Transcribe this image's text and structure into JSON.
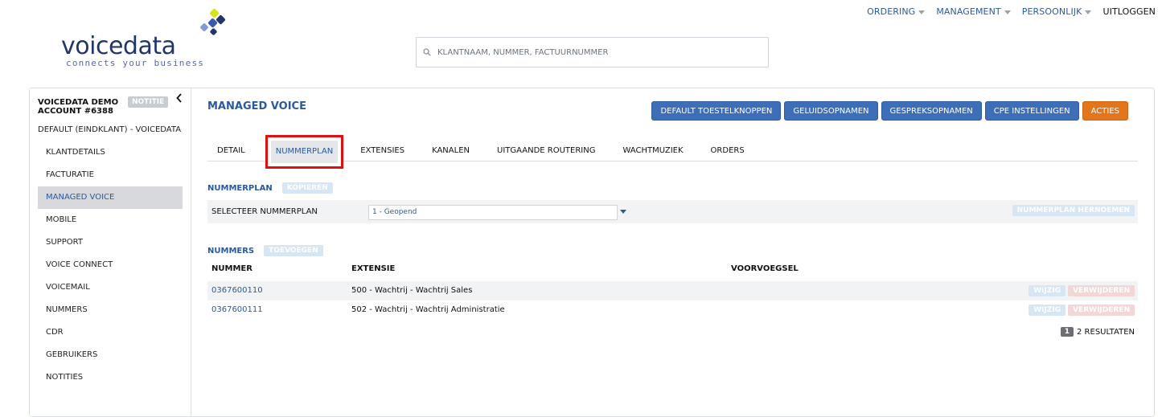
{
  "topnav": {
    "items": [
      {
        "label": "ORDERING",
        "dropdown": true
      },
      {
        "label": "MANAGEMENT",
        "dropdown": true
      },
      {
        "label": "PERSOONLIJK",
        "dropdown": true
      },
      {
        "label": "UITLOGGEN",
        "dropdown": false
      }
    ]
  },
  "logo": {
    "word": "voicedata",
    "tagline": "connects your business"
  },
  "search": {
    "placeholder": "KLANTNAAM, NUMMER, FACTUURNUMMER",
    "value": "",
    "icon": "search-icon"
  },
  "sidebar": {
    "account": "VOICEDATA DEMO ACCOUNT #6388",
    "notitie_label": "NOTITIE",
    "collapse_icon": "chevron-left-icon",
    "default_label": "DEFAULT (EINDKLANT) - VOICEDATA",
    "items": [
      {
        "label": "KLANTDETAILS",
        "active": false
      },
      {
        "label": "FACTURATIE",
        "active": false
      },
      {
        "label": "MANAGED VOICE",
        "active": true
      },
      {
        "label": "MOBILE",
        "active": false
      },
      {
        "label": "SUPPORT",
        "active": false
      },
      {
        "label": "VOICE CONNECT",
        "active": false
      },
      {
        "label": "VOICEMAIL",
        "active": false
      },
      {
        "label": "NUMMERS",
        "active": false
      },
      {
        "label": "CDR",
        "active": false
      },
      {
        "label": "GEBRUIKERS",
        "active": false
      },
      {
        "label": "NOTITIES",
        "active": false
      }
    ]
  },
  "main": {
    "title": "MANAGED VOICE",
    "actions": [
      {
        "label": "DEFAULT TOESTELKNOPPEN",
        "variant": "blue"
      },
      {
        "label": "GELUIDSOPNAMEN",
        "variant": "blue"
      },
      {
        "label": "GESPREKSOPNAMEN",
        "variant": "blue"
      },
      {
        "label": "CPE INSTELLINGEN",
        "variant": "blue"
      },
      {
        "label": "ACTIES",
        "variant": "orange"
      }
    ],
    "tabs": [
      {
        "label": "DETAIL",
        "active": false
      },
      {
        "label": "NUMMERPLAN",
        "active": true
      },
      {
        "label": "EXTENSIES",
        "active": false
      },
      {
        "label": "KANALEN",
        "active": false
      },
      {
        "label": "UITGAANDE ROUTERING",
        "active": false
      },
      {
        "label": "WACHTMUZIEK",
        "active": false
      },
      {
        "label": "ORDERS",
        "active": false
      }
    ],
    "nummerplan": {
      "heading": "NUMMERPLAN",
      "copy_label": "KOPIEREN",
      "select_label": "SELECTEER NUMMERPLAN",
      "select_value": "1 - Geopend",
      "rename_label": "NUMMERPLAN HERNOEMEN"
    },
    "nummers": {
      "heading": "NUMMERS",
      "add_label": "TOEVOEGEN",
      "columns": [
        "NUMMER",
        "EXTENSIE",
        "VOORVOEGSEL"
      ],
      "rows": [
        {
          "nummer": "0367600110",
          "extensie": "500 - Wachtrij - Wachtrij Sales",
          "voorvoegsel": ""
        },
        {
          "nummer": "0367600111",
          "extensie": "502 - Wachtrij - Wachtrij Administratie",
          "voorvoegsel": ""
        }
      ],
      "edit_label": "WIJZIG",
      "delete_label": "VERWIJDEREN",
      "page": "1",
      "results_label": "2 RESULTATEN"
    }
  },
  "colors": {
    "primary": "#3d6fb8",
    "link": "#2b5a9c",
    "orange": "#e3761d",
    "highlight": "#e01010"
  }
}
